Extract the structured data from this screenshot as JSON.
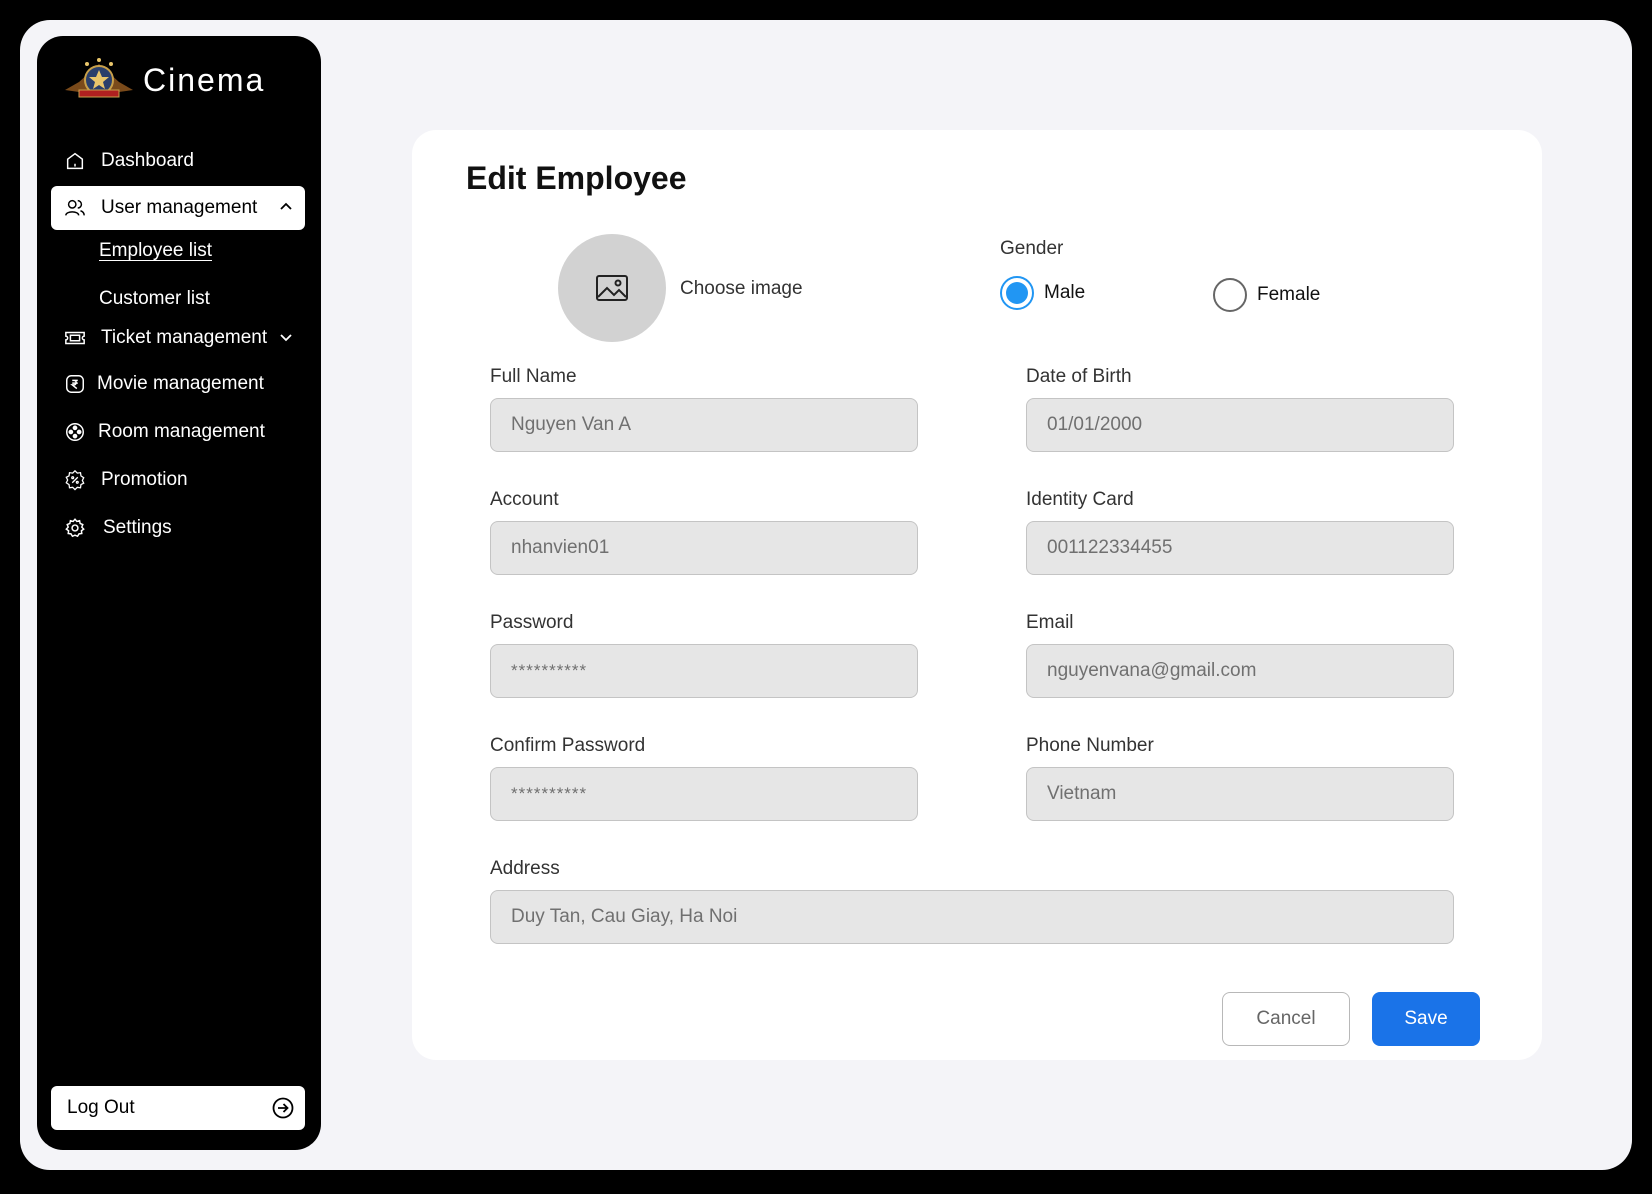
{
  "brand": {
    "name": "Cinema"
  },
  "sidebar": {
    "items": [
      {
        "label": "Dashboard",
        "icon": "home-icon"
      },
      {
        "label": "User management",
        "icon": "users-icon",
        "expanded": true,
        "children": [
          {
            "label": "Employee list",
            "current": true
          },
          {
            "label": "Customer list",
            "current": false
          }
        ]
      },
      {
        "label": "Ticket management",
        "icon": "ticket-icon",
        "expanded": false
      },
      {
        "label": "Movie management",
        "icon": "rupee-coin-icon"
      },
      {
        "label": "Room management",
        "icon": "film-reel-icon"
      },
      {
        "label": "Promotion",
        "icon": "percent-badge-icon"
      },
      {
        "label": "Settings",
        "icon": "gear-icon"
      }
    ],
    "logout_label": "Log Out"
  },
  "form": {
    "title": "Edit Employee",
    "choose_image_label": "Choose image",
    "gender": {
      "label": "Gender",
      "options": [
        {
          "label": "Male",
          "selected": true
        },
        {
          "label": "Female",
          "selected": false
        }
      ]
    },
    "fields": {
      "full_name": {
        "label": "Full Name",
        "value": "Nguyen Van A"
      },
      "date_of_birth": {
        "label": "Date of Birth",
        "value": "01/01/2000"
      },
      "account": {
        "label": "Account",
        "value": "nhanvien01"
      },
      "identity_card": {
        "label": "Identity Card",
        "value": "001122334455"
      },
      "password": {
        "label": "Password",
        "value": "**********"
      },
      "email": {
        "label": "Email",
        "value": "nguyenvana@gmail.com"
      },
      "confirm_password": {
        "label": "Confirm Password",
        "value": "**********"
      },
      "phone_number": {
        "label": "Phone Number",
        "value": "Vietnam"
      },
      "address": {
        "label": "Address",
        "value": "Duy Tan, Cau Giay, Ha Noi"
      }
    },
    "cancel_label": "Cancel",
    "save_label": "Save"
  },
  "colors": {
    "accent": "#1a73e8",
    "radio": "#2196f3",
    "sidebar_bg": "#000000",
    "page_bg": "#f4f4f8"
  }
}
